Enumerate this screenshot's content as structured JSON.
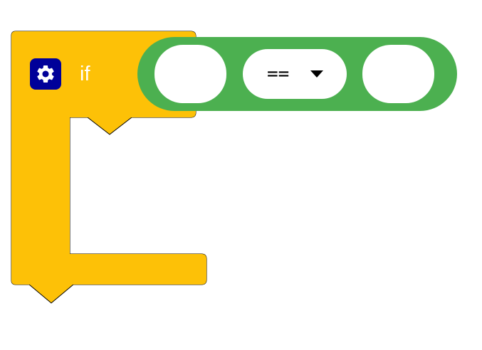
{
  "if_block": {
    "keyword": "if",
    "color": "#fdc107",
    "settings_icon": "gear-icon",
    "settings_button_color": "#000099"
  },
  "condition_block": {
    "color": "#4cb050",
    "operator": {
      "value": "==",
      "caret_icon": "caret-down-icon"
    }
  }
}
